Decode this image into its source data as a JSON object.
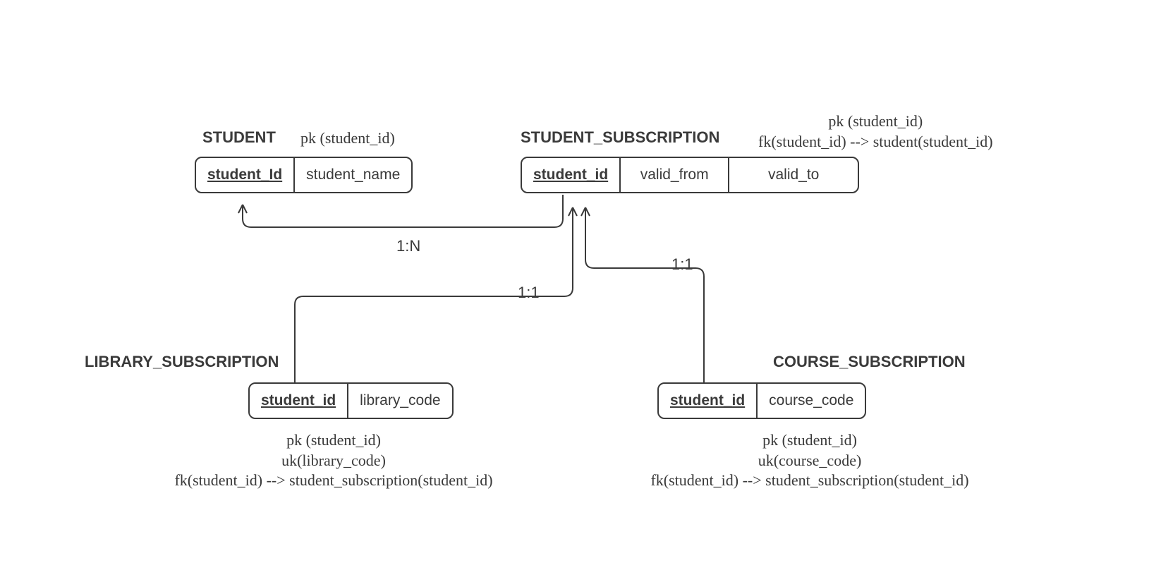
{
  "entities": {
    "student": {
      "title": "STUDENT",
      "columns": {
        "pk": "student_Id",
        "c1": "student_name"
      },
      "constraints": {
        "line1": "pk (student_id)"
      }
    },
    "student_subscription": {
      "title": "STUDENT_SUBSCRIPTION",
      "columns": {
        "pk": "student_id",
        "c1": "valid_from",
        "c2": "valid_to"
      },
      "constraints": {
        "line1": "pk (student_id)",
        "line2": "fk(student_id) --> student(student_id)"
      }
    },
    "library_subscription": {
      "title": "LIBRARY_SUBSCRIPTION",
      "columns": {
        "pk": "student_id",
        "c1": "library_code"
      },
      "constraints": {
        "line1": "pk (student_id)",
        "line2": "uk(library_code)",
        "line3": "fk(student_id) --> student_subscription(student_id)"
      }
    },
    "course_subscription": {
      "title": "COURSE_SUBSCRIPTION",
      "columns": {
        "pk": "student_id",
        "c1": "course_code"
      },
      "constraints": {
        "line1": "pk (student_id)",
        "line2": "uk(course_code)",
        "line3": "fk(student_id) --> student_subscription(student_id)"
      }
    }
  },
  "relationships": {
    "student_to_subscription": "1:N",
    "subscription_to_library": "1:1",
    "subscription_to_course": "1:1"
  }
}
